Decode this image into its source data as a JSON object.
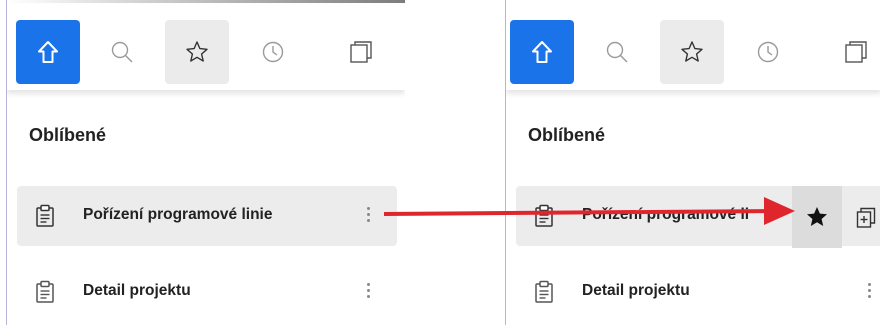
{
  "toolbar_icons": [
    "home-icon",
    "search-icon",
    "star-outline-icon",
    "history-clock-icon",
    "stacked-pages-icon"
  ],
  "colors": {
    "active": "#1a73e8",
    "arrow": "#e0262d",
    "hover_row": "#ececec"
  },
  "left": {
    "section_title": "Oblíbené",
    "items": [
      {
        "label": "Pořízení programové linie"
      },
      {
        "label": "Detail projektu"
      }
    ]
  },
  "right": {
    "section_title": "Oblíbené",
    "items": [
      {
        "label": "Pořízení programové li"
      },
      {
        "label": "Detail projektu"
      }
    ],
    "row_actions": [
      "star-filled-icon",
      "add-copy-icon"
    ]
  }
}
